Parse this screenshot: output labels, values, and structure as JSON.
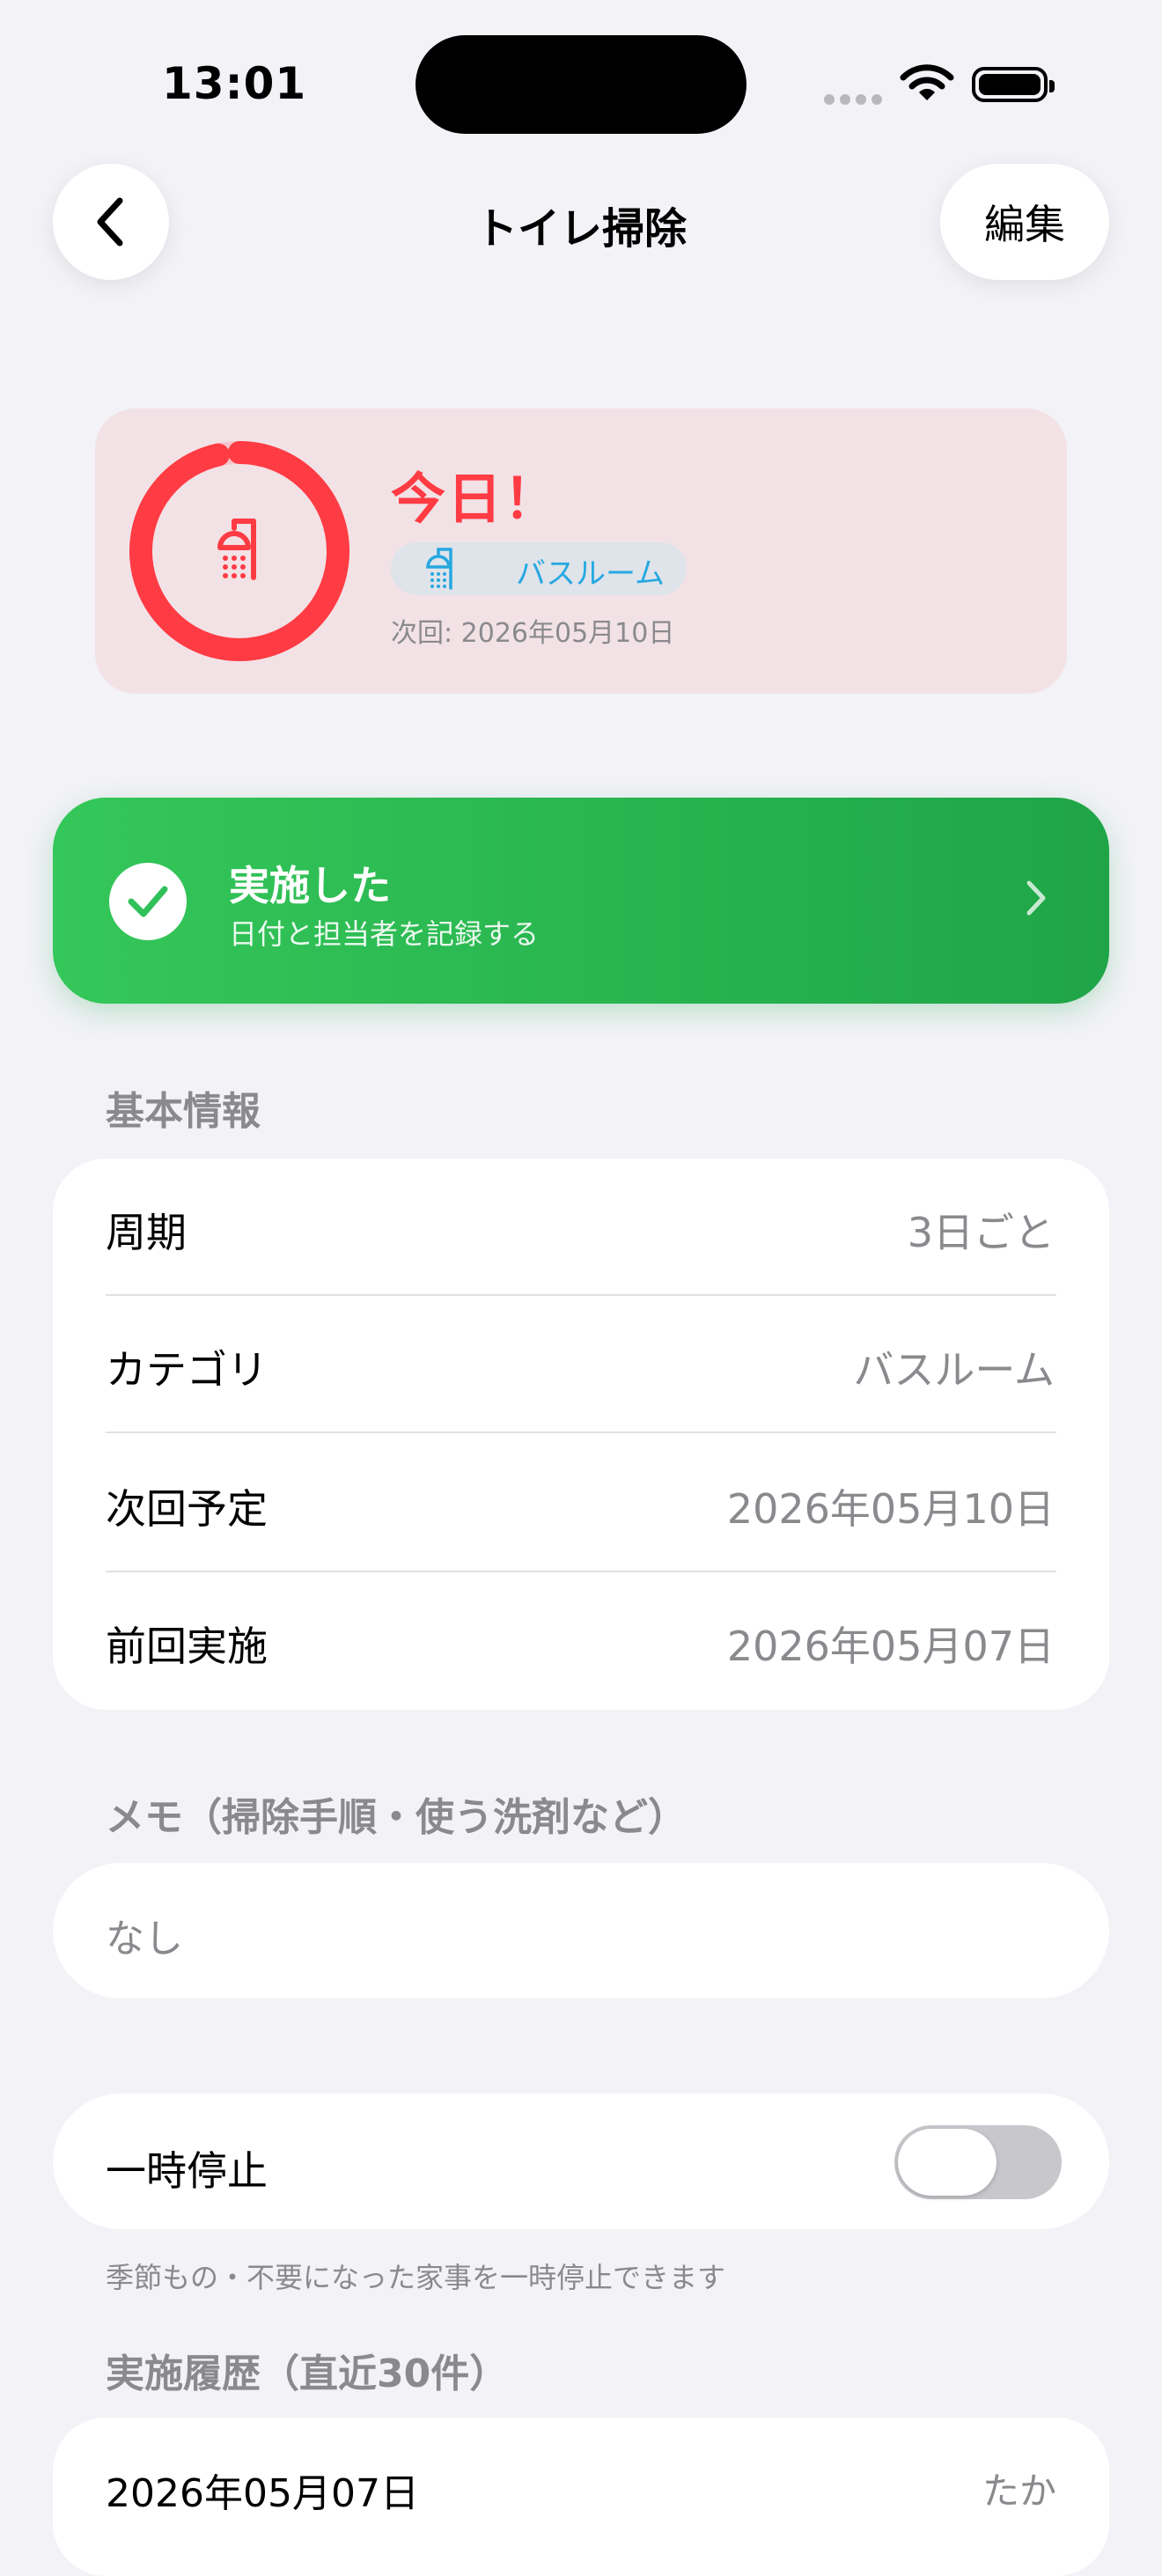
{
  "status_bar": {
    "time": "13:01"
  },
  "nav": {
    "title": "トイレ掃除",
    "edit_label": "編集",
    "back_icon": "chevron-left-icon"
  },
  "status_card": {
    "status_text": "今日！",
    "category": "バスルーム",
    "category_icon": "shower-icon",
    "next_text": "次回: 2026年05月10日",
    "ring_progress": 1.0,
    "colors": {
      "accent": "#ff3b44",
      "card_bg": "#f2e2e6",
      "badge_text": "#25a8e0"
    }
  },
  "done_button": {
    "title": "実施した",
    "subtitle": "日付と担当者を記録する",
    "colors": {
      "start": "#34c759",
      "end": "#1fa548"
    }
  },
  "basic_info": {
    "header": "基本情報",
    "rows": [
      {
        "label": "周期",
        "value": "3日ごと"
      },
      {
        "label": "カテゴリ",
        "value": "バスルーム"
      },
      {
        "label": "次回予定",
        "value": "2026年05月10日"
      },
      {
        "label": "前回実施",
        "value": "2026年05月07日"
      }
    ]
  },
  "memo": {
    "header": "メモ（掃除手順・使う洗剤など）",
    "value": "なし"
  },
  "pause": {
    "label": "一時停止",
    "enabled": false,
    "note": "季節もの・不要になった家事を一時停止できます"
  },
  "history": {
    "header": "実施履歴（直近30件）",
    "items": [
      {
        "date": "2026年05月07日",
        "who": "たか"
      }
    ]
  }
}
